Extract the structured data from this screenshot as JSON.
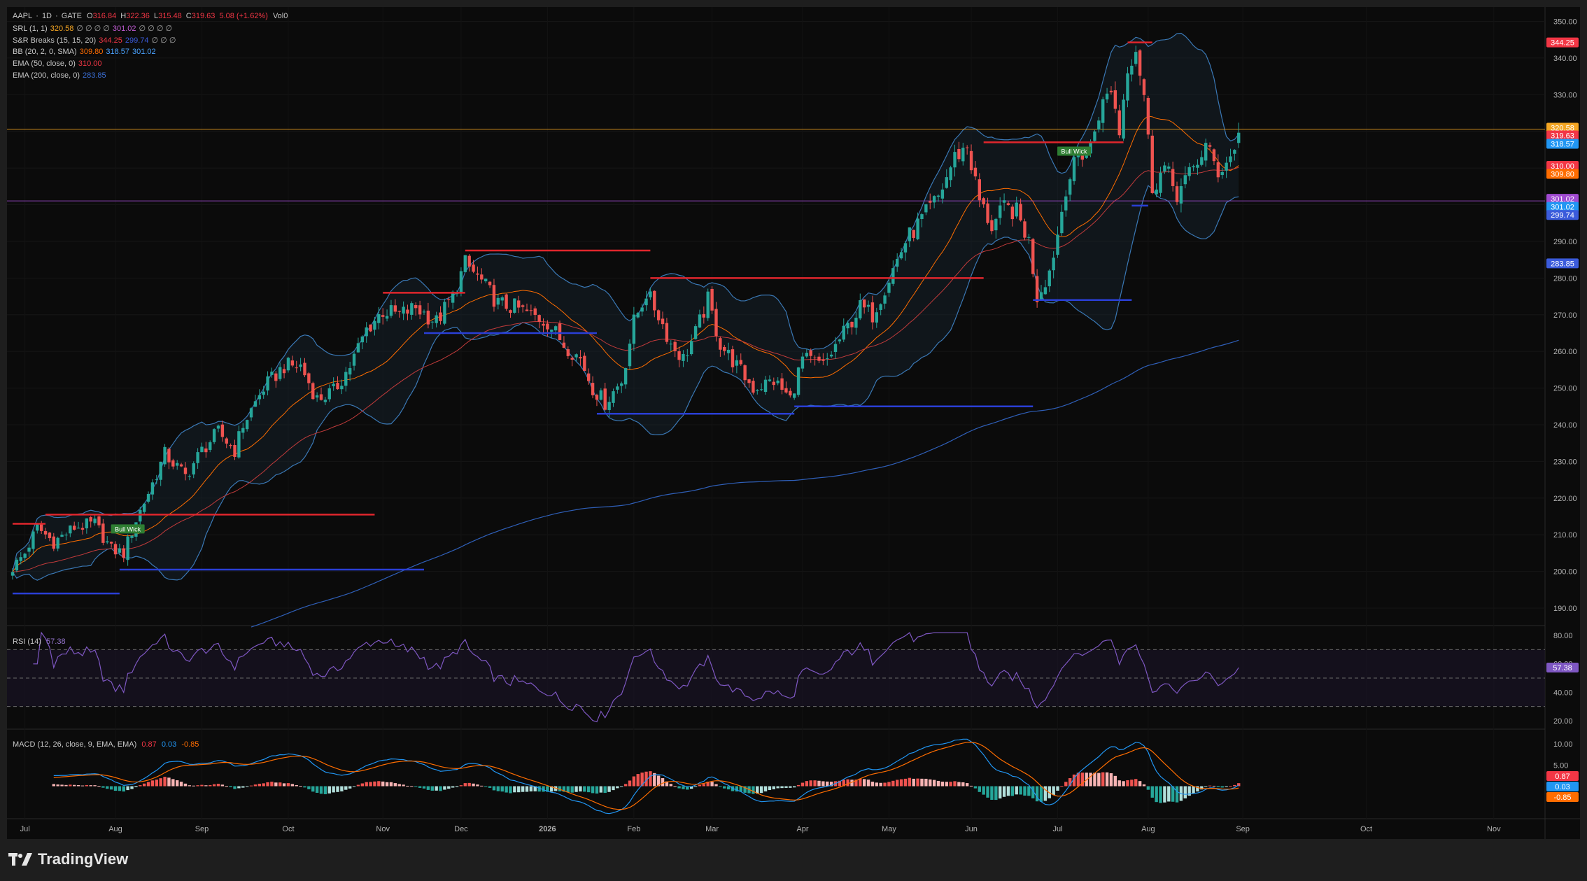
{
  "symbol_line": {
    "symbol": "AAPL",
    "sep1": "·",
    "interval": "1D",
    "sep2": "·",
    "exchange": "GATE",
    "o_label": "O",
    "o": "316.84",
    "h_label": "H",
    "h": "322.36",
    "l_label": "L",
    "l": "315.48",
    "c_label": "C",
    "c": "319.63",
    "chg": "5.08 (+1.62%)",
    "vol": "Vol0"
  },
  "indicators": [
    {
      "name": "SRL (1, 1)",
      "values": [
        {
          "v": "320.58",
          "color": "#f5a623"
        },
        {
          "v": "∅ ∅ ∅ ∅",
          "color": "#aaaaaa"
        },
        {
          "v": "301.02",
          "color": "#c45dd6"
        },
        {
          "v": "∅ ∅ ∅ ∅",
          "color": "#aaaaaa"
        }
      ]
    },
    {
      "name": "S&R Breaks (15, 15, 20)",
      "values": [
        {
          "v": "344.25",
          "color": "#f23645"
        },
        {
          "v": "299.74",
          "color": "#3b5bdb"
        },
        {
          "v": "∅ ∅ ∅",
          "color": "#aaaaaa"
        }
      ]
    },
    {
      "name": "BB (20, 2, 0, SMA)",
      "values": [
        {
          "v": "309.80",
          "color": "#ff6d00"
        },
        {
          "v": "318.57",
          "color": "#4aa3ff"
        },
        {
          "v": "301.02",
          "color": "#4aa3ff"
        }
      ]
    },
    {
      "name": "EMA (50, close, 0)",
      "values": [
        {
          "v": "310.00",
          "color": "#f23645"
        }
      ]
    },
    {
      "name": "EMA (200, close, 0)",
      "values": [
        {
          "v": "283.85",
          "color": "#3b6fd6"
        }
      ]
    }
  ],
  "rsi_label": {
    "name": "RSI (14)",
    "value": "57.38",
    "color": "#9575cd"
  },
  "macd_label": {
    "name": "MACD (12, 26, close, 9, EMA, EMA)",
    "macd": "0.87",
    "signal": "0.03",
    "hist": "-0.85"
  },
  "chart_data": {
    "type": "candlestick",
    "price_axis": {
      "min": 186,
      "max": 352,
      "ticks": [
        350,
        340,
        330,
        320,
        310,
        300,
        290,
        280,
        270,
        260,
        250,
        240,
        230,
        220,
        210,
        200,
        190
      ],
      "tick_labels": [
        "350.00",
        "340.00",
        "330.00",
        "320.00",
        "310.00",
        "300.00",
        "290.00",
        "280.00",
        "270.00",
        "260.00",
        "250.00",
        "240.00",
        "230.00",
        "220.00",
        "210.00",
        "200.00",
        "190.00"
      ]
    },
    "rsi_axis": {
      "min": 15,
      "max": 85,
      "ticks": [
        80,
        60,
        40,
        20
      ],
      "tick_labels": [
        "80.00",
        "60.00",
        "40.00",
        "20.00"
      ],
      "bands": [
        70,
        50,
        30
      ]
    },
    "macd_axis": {
      "min": -11,
      "max": 13,
      "ticks": [
        10,
        5
      ],
      "tick_labels": [
        "10.00",
        "5.00"
      ]
    },
    "time_axis": {
      "labels": [
        {
          "label": "Jul",
          "bar": 3
        },
        {
          "label": "Aug",
          "bar": 25
        },
        {
          "label": "Sep",
          "bar": 46
        },
        {
          "label": "Oct",
          "bar": 67
        },
        {
          "label": "Nov",
          "bar": 90
        },
        {
          "label": "Dec",
          "bar": 109
        },
        {
          "label": "2026",
          "bar": 130
        },
        {
          "label": "Feb",
          "bar": 151
        },
        {
          "label": "Mar",
          "bar": 170
        },
        {
          "label": "Apr",
          "bar": 192
        },
        {
          "label": "May",
          "bar": 213
        },
        {
          "label": "Jun",
          "bar": 233
        },
        {
          "label": "Jul",
          "bar": 254
        },
        {
          "label": "Aug",
          "bar": 276
        },
        {
          "label": "Sep",
          "bar": 299
        },
        {
          "label": "Oct",
          "bar": 329
        },
        {
          "label": "Nov",
          "bar": 360
        }
      ],
      "total_bars": 370
    },
    "close_anchors": [
      [
        0,
        201
      ],
      [
        3,
        205
      ],
      [
        6,
        212
      ],
      [
        10,
        208
      ],
      [
        15,
        212
      ],
      [
        20,
        213
      ],
      [
        24,
        206
      ],
      [
        27,
        205
      ],
      [
        30,
        214
      ],
      [
        34,
        224
      ],
      [
        37,
        232
      ],
      [
        42,
        226
      ],
      [
        46,
        233
      ],
      [
        50,
        238
      ],
      [
        54,
        233
      ],
      [
        56,
        240
      ],
      [
        61,
        250
      ],
      [
        66,
        256
      ],
      [
        70,
        256
      ],
      [
        74,
        247
      ],
      [
        78,
        249
      ],
      [
        82,
        256
      ],
      [
        86,
        266
      ],
      [
        90,
        271
      ],
      [
        94,
        270
      ],
      [
        98,
        272
      ],
      [
        103,
        268
      ],
      [
        107,
        275
      ],
      [
        110,
        284
      ],
      [
        114,
        279
      ],
      [
        118,
        273
      ],
      [
        122,
        272
      ],
      [
        126,
        270
      ],
      [
        130,
        268
      ],
      [
        134,
        262
      ],
      [
        138,
        258
      ],
      [
        141,
        250
      ],
      [
        144,
        246
      ],
      [
        148,
        252
      ],
      [
        151,
        268
      ],
      [
        154,
        276
      ],
      [
        157,
        270
      ],
      [
        160,
        262
      ],
      [
        163,
        258
      ],
      [
        166,
        265
      ],
      [
        169,
        274
      ],
      [
        172,
        262
      ],
      [
        176,
        256
      ],
      [
        180,
        250
      ],
      [
        185,
        252
      ],
      [
        189,
        247
      ],
      [
        192,
        258
      ],
      [
        197,
        256
      ],
      [
        202,
        265
      ],
      [
        206,
        272
      ],
      [
        209,
        270
      ],
      [
        213,
        280
      ],
      [
        217,
        290
      ],
      [
        221,
        296
      ],
      [
        225,
        302
      ],
      [
        229,
        313
      ],
      [
        232,
        316
      ],
      [
        235,
        301
      ],
      [
        238,
        294
      ],
      [
        241,
        299
      ],
      [
        244,
        298
      ],
      [
        247,
        290
      ],
      [
        249,
        275
      ],
      [
        252,
        282
      ],
      [
        254,
        292
      ],
      [
        256,
        305
      ],
      [
        259,
        313
      ],
      [
        262,
        316
      ],
      [
        264,
        325
      ],
      [
        267,
        332
      ],
      [
        269,
        320
      ],
      [
        271,
        338
      ],
      [
        273,
        343
      ],
      [
        275,
        330
      ],
      [
        277,
        305
      ],
      [
        280,
        310
      ],
      [
        283,
        303
      ],
      [
        286,
        308
      ],
      [
        290,
        316
      ],
      [
        293,
        309
      ],
      [
        296,
        313
      ],
      [
        298,
        319.63
      ]
    ],
    "last": {
      "open": 316.84,
      "high": 322.36,
      "low": 315.48,
      "close": 319.63
    },
    "levels": [
      {
        "type": "srl",
        "value": 320.58,
        "color": "#f5a623"
      },
      {
        "type": "srl",
        "value": 301.02,
        "color": "#a14bd1"
      }
    ],
    "sr_breaks": [
      {
        "side": "resistance",
        "value": 213,
        "from": 0,
        "to": 8
      },
      {
        "side": "resistance",
        "value": 215.5,
        "from": 8,
        "to": 88
      },
      {
        "side": "support",
        "value": 194,
        "from": 0,
        "to": 26
      },
      {
        "side": "support",
        "value": 200.5,
        "from": 26,
        "to": 100
      },
      {
        "side": "resistance",
        "value": 276,
        "from": 90,
        "to": 110
      },
      {
        "side": "resistance",
        "value": 287.5,
        "from": 110,
        "to": 155
      },
      {
        "side": "support",
        "value": 265,
        "from": 100,
        "to": 142
      },
      {
        "side": "support",
        "value": 243,
        "from": 142,
        "to": 190
      },
      {
        "side": "support",
        "value": 245,
        "from": 190,
        "to": 248
      },
      {
        "side": "resistance",
        "value": 280,
        "from": 155,
        "to": 236
      },
      {
        "side": "resistance",
        "value": 317,
        "from": 236,
        "to": 270
      },
      {
        "side": "support",
        "value": 274,
        "from": 248,
        "to": 272
      },
      {
        "side": "resistance",
        "value": 344.25,
        "from": 271,
        "to": 277
      },
      {
        "side": "support",
        "value": 299.74,
        "from": 272,
        "to": 276
      }
    ],
    "labels": [
      {
        "text": "Bull Wick",
        "bar": 28,
        "price": 211.5
      },
      {
        "text": "Bull Wick",
        "bar": 258,
        "price": 314.5
      }
    ],
    "price_tags": [
      {
        "value": "344.25",
        "price": 344.25,
        "bg": "#f23645"
      },
      {
        "value": "320.58",
        "price": 321.0,
        "bg": "#f5a623"
      },
      {
        "value": "319.63",
        "price": 318.9,
        "bg": "#f23645"
      },
      {
        "value": "318.57",
        "price": 316.6,
        "bg": "#2196f3"
      },
      {
        "value": "310.00",
        "price": 310.6,
        "bg": "#f23645"
      },
      {
        "value": "309.80",
        "price": 308.4,
        "bg": "#ff6d00"
      },
      {
        "value": "301.02",
        "price": 301.6,
        "bg": "#a14bd1"
      },
      {
        "value": "301.02",
        "price": 299.4,
        "bg": "#2196f3"
      },
      {
        "value": "299.74",
        "price": 297.2,
        "bg": "#3b5bdb"
      },
      {
        "value": "283.85",
        "price": 284.0,
        "bg": "#3b5bdb"
      }
    ],
    "rsi_tag": {
      "value": "57.38",
      "bg": "#7e57c2"
    },
    "macd_tags": [
      {
        "value": "0.87",
        "bg": "#f23645"
      },
      {
        "value": "0.03",
        "bg": "#2196f3"
      },
      {
        "value": "-0.85",
        "bg": "#ff6d00"
      }
    ]
  },
  "brand": {
    "name": "TradingView"
  }
}
